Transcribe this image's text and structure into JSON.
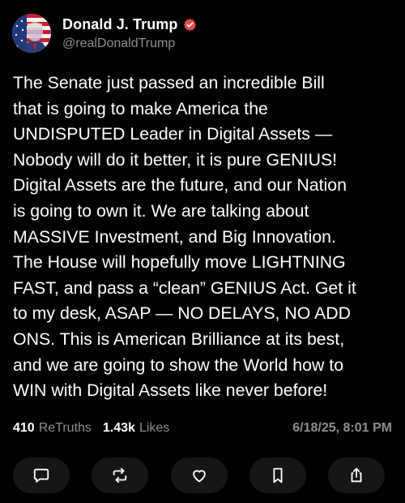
{
  "post": {
    "author": {
      "display_name": "Donald J. Trump",
      "handle": "@realDonaldTrump",
      "verified": true,
      "verified_badge_color": "#e5484d"
    },
    "text_lines": [
      "The Senate just passed an incredible Bill",
      "that is going to make America the",
      "UNDISPUTED Leader in Digital Assets —",
      "Nobody will do it better, it is pure GENIUS!",
      "Digital Assets are the future, and our Nation",
      "is going to own it. We are talking about",
      "MASSIVE Investment, and Big Innovation.",
      "The House will hopefully move LIGHTNING",
      "FAST, and pass a “clean” GENIUS Act. Get it",
      "to my desk, ASAP — NO DELAYS, NO ADD",
      "ONS. This is American Brilliance at its best,",
      "and we are going to show the World how to",
      "WIN with Digital Assets like never before!"
    ],
    "stats": {
      "retruths_count": "410",
      "retruths_label": "ReTruths",
      "likes_count": "1.43k",
      "likes_label": "Likes",
      "timestamp": "6/18/25, 8:01 PM"
    },
    "actions": [
      {
        "name": "reply-button",
        "icon": "comment-icon"
      },
      {
        "name": "retruth-button",
        "icon": "repost-icon"
      },
      {
        "name": "like-button",
        "icon": "heart-icon"
      },
      {
        "name": "bookmark-button",
        "icon": "bookmark-icon"
      },
      {
        "name": "share-button",
        "icon": "share-icon"
      }
    ]
  },
  "colors": {
    "background": "#000000",
    "text": "#ffffff",
    "muted": "#8e8e93",
    "button_bg": "#161618"
  }
}
